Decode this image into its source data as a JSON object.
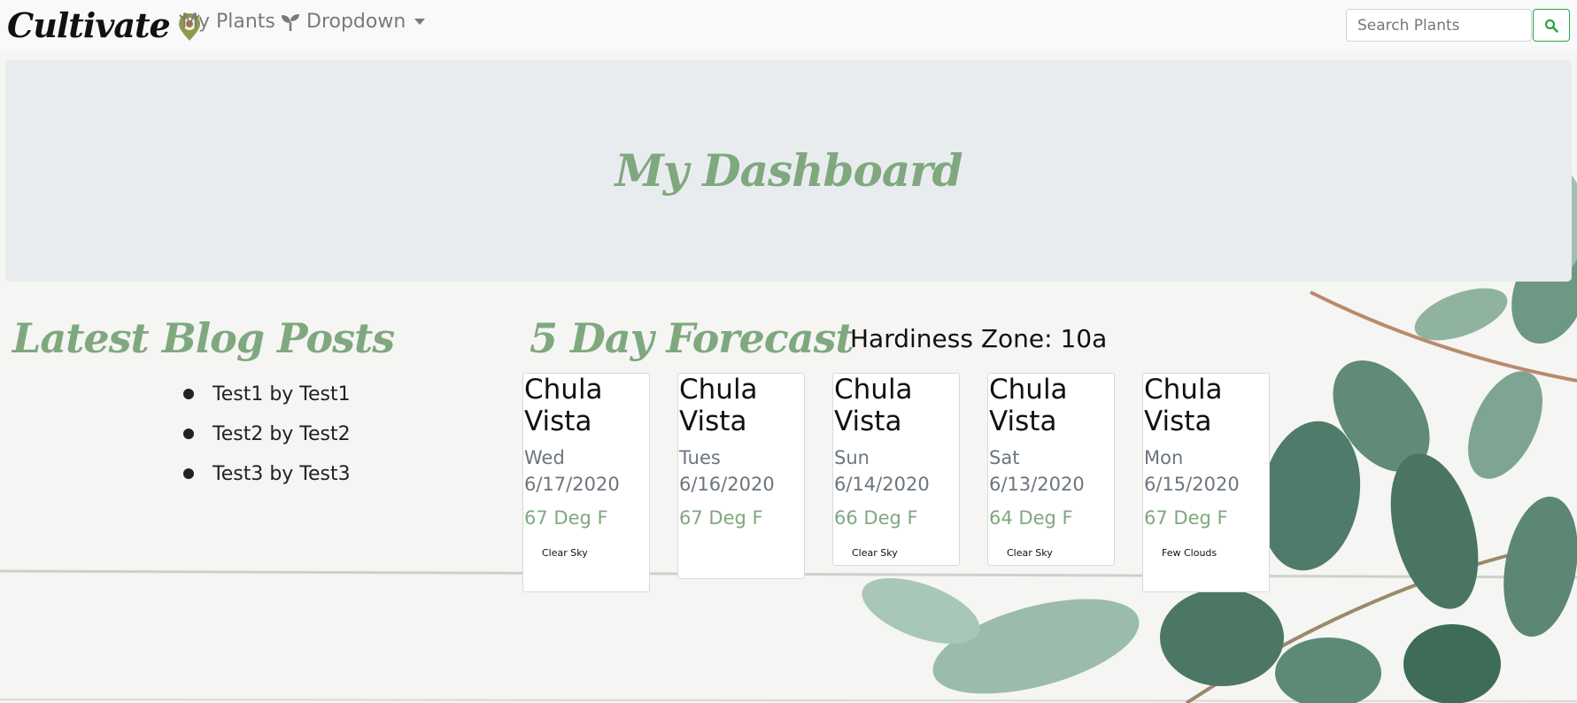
{
  "navbar": {
    "brand": "Cultivate",
    "links": [
      {
        "label": "My Plants",
        "icon": "seedling-icon"
      },
      {
        "label": "Dropdown",
        "icon": "caret-down-icon"
      }
    ],
    "search": {
      "placeholder": "Search Plants",
      "button_icon": "search-icon"
    }
  },
  "jumbotron": {
    "title": "My Dashboard"
  },
  "blog": {
    "title": "Latest Blog Posts",
    "posts": [
      "Test1 by Test1",
      "Test2 by Test2",
      "Test3 by Test3"
    ]
  },
  "forecast": {
    "title": "5 Day Forecast",
    "hardiness_zone": "Hardiness Zone: 10a",
    "cards": [
      {
        "city": "Chula Vista",
        "date": "Wed 6/17/2020",
        "temp": "67 Deg F",
        "desc": "Clear Sky"
      },
      {
        "city": "Chula Vista",
        "date": "Tues 6/16/2020",
        "temp": "67 Deg F",
        "desc": ""
      },
      {
        "city": "Chula Vista",
        "date": "Sun 6/14/2020",
        "temp": "66 Deg F",
        "desc": "Clear Sky"
      },
      {
        "city": "Chula Vista",
        "date": "Sat 6/13/2020",
        "temp": "64 Deg F",
        "desc": "Clear Sky"
      },
      {
        "city": "Chula Vista",
        "date": "Mon 6/15/2020",
        "temp": "67 Deg F",
        "desc": "Few Clouds"
      }
    ]
  },
  "colors": {
    "accent_green": "#7fa87e",
    "search_border": "#28a745",
    "jumbotron_bg": "#e9ecef"
  }
}
